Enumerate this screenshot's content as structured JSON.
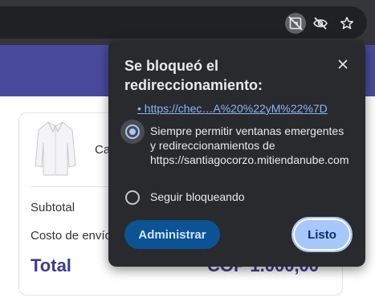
{
  "browser": {
    "icons": [
      "popup-blocked-icon",
      "eye-off-icon",
      "star-icon"
    ]
  },
  "page": {
    "product_name": "Ca",
    "subtotal_label": "Subtotal",
    "shipping_label": "Costo de envío",
    "total_label": "Total",
    "total_value": "COP 1.000,00"
  },
  "popup": {
    "title": "Se bloqueó el redireccionamiento:",
    "blocked_link": "• https://chec…A%20%22yM%22%7D",
    "option_allow": "Siempre permitir ventanas emergentes y redireccionamientos de https://santiagocorzo.mitiendanube.com",
    "option_block": "Seguir bloqueando",
    "selected_option": "option_allow",
    "manage_button": "Administrar",
    "done_button": "Listo"
  },
  "colors": {
    "page_accent": "#4a4a9c",
    "popup_bg": "#292a2d",
    "link": "#8ab4f8",
    "primary_button": "#a8c7fa",
    "secondary_button": "#0b5394"
  }
}
